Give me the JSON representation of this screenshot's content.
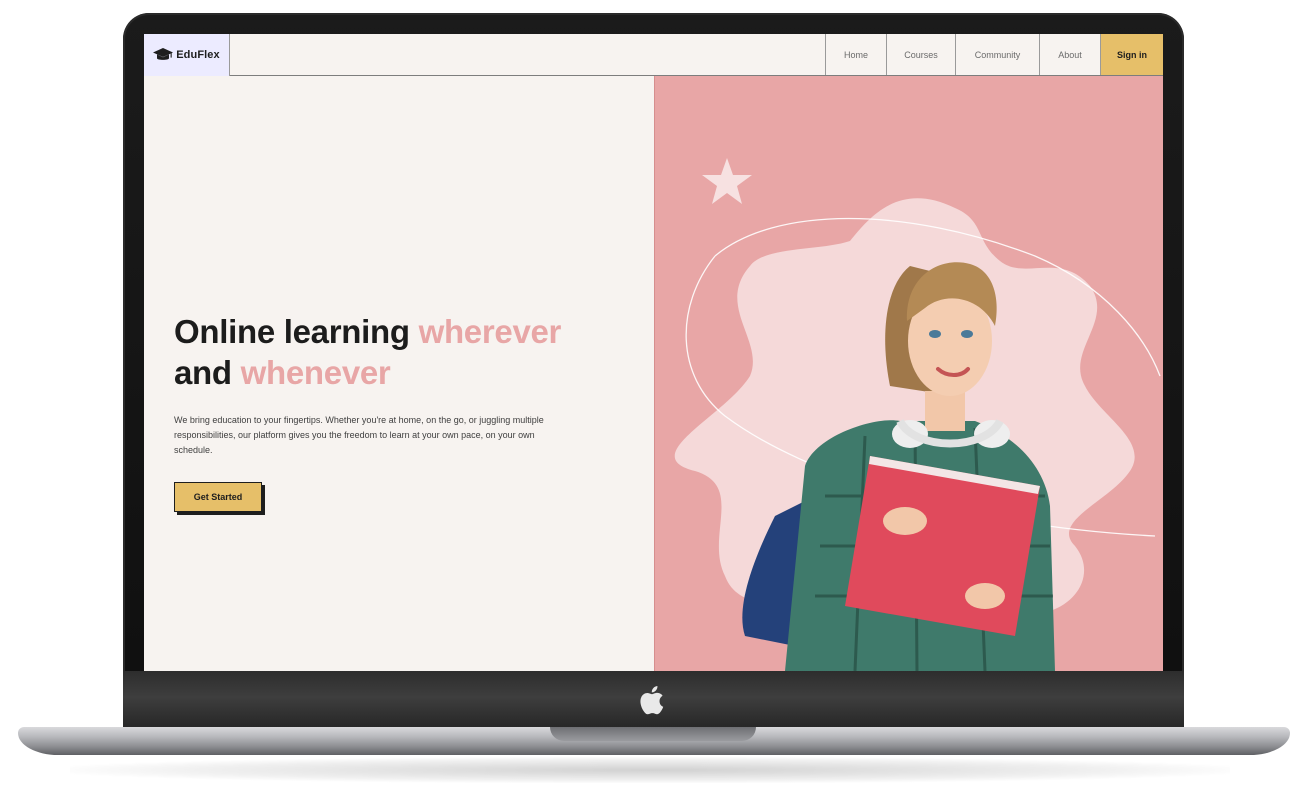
{
  "brand": {
    "name": "EduFlex"
  },
  "nav": {
    "items": [
      {
        "label": "Home"
      },
      {
        "label": "Courses"
      },
      {
        "label": "Community"
      },
      {
        "label": "About"
      }
    ],
    "signin_label": "Sign in"
  },
  "hero": {
    "title_part1": "Online learning ",
    "title_highlight1": "wherever",
    "title_part2": "and ",
    "title_highlight2": "whenever",
    "description": "We bring education to your fingertips. Whether you're at home, on the go, or juggling multiple responsibilities, our platform gives you the freedom to learn at your own pace, on your own schedule.",
    "cta_label": "Get Started"
  },
  "colors": {
    "accent_pink": "#e8a6a6",
    "light_pink": "#f5d9d9",
    "accent_yellow": "#e6bf69",
    "background": "#f7f3f0",
    "logo_bg": "#ecebff"
  },
  "icons": {
    "logo": "graduation-cap-icon",
    "decoration": "star-icon",
    "device": "apple-logo-icon"
  }
}
